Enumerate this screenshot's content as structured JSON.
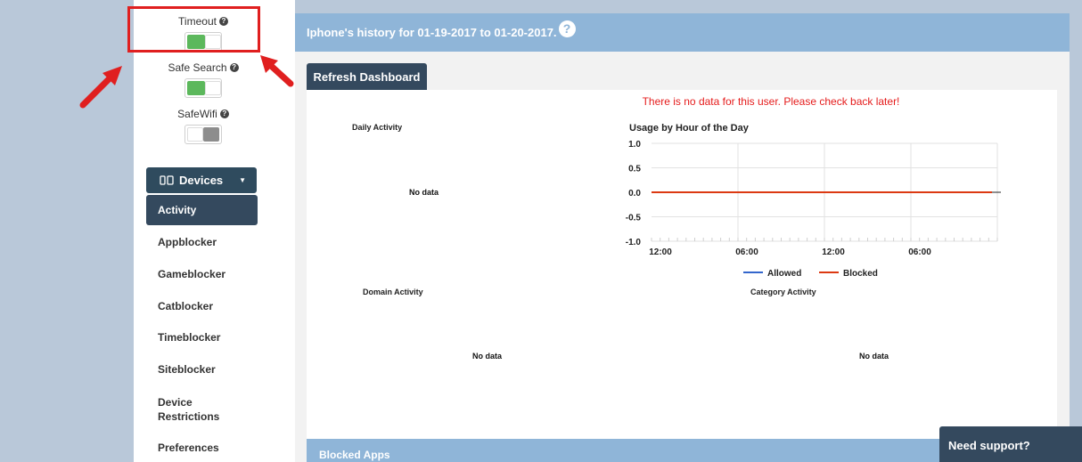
{
  "sidebar": {
    "toggles": [
      {
        "label": "Timeout",
        "state": "on"
      },
      {
        "label": "Safe Search",
        "state": "on"
      },
      {
        "label": "SafeWifi",
        "state": "off"
      }
    ],
    "help_glyph": "?",
    "devices_button": {
      "label": "Devices",
      "icons": [
        "phone-icon",
        "tablet-icon"
      ]
    },
    "nav_items": [
      {
        "label": "Activity",
        "active": true
      },
      {
        "label": "Appblocker"
      },
      {
        "label": "Gameblocker"
      },
      {
        "label": "Catblocker"
      },
      {
        "label": "Timeblocker"
      },
      {
        "label": "Siteblocker"
      },
      {
        "label": "Device Restrictions"
      },
      {
        "label": "Preferences"
      }
    ]
  },
  "main": {
    "header_title": "Iphone's history for 01-19-2017 to 01-20-2017.",
    "help_glyph": "?",
    "refresh_label": "Refresh Dashboard",
    "no_data_message": "There is no data for this user. Please check back later!",
    "daily_activity": {
      "title": "Daily Activity",
      "empty": "No data"
    },
    "domain_activity": {
      "title": "Domain Activity",
      "empty": "No data"
    },
    "category_activity": {
      "title": "Category Activity",
      "empty": "No data"
    },
    "blocked_apps_label": "Blocked Apps"
  },
  "support_label": "Need support?",
  "colors": {
    "accent_dark": "#34495e",
    "header_blue": "#8fb5d8",
    "toggle_on": "#5cb85c",
    "alert_red": "#e51c1c",
    "allowed_line": "#3366cc",
    "blocked_line": "#dc3912"
  },
  "chart_data": {
    "type": "line",
    "title": "Usage by Hour of the Day",
    "x_ticks": [
      "12:00",
      "06:00",
      "12:00",
      "06:00"
    ],
    "y_ticks": [
      "1.0",
      "0.5",
      "0.0",
      "-0.5",
      "-1.0"
    ],
    "ylim": [
      -1.0,
      1.0
    ],
    "series": [
      {
        "name": "Allowed",
        "color": "#3366cc",
        "values": [
          0,
          0
        ]
      },
      {
        "name": "Blocked",
        "color": "#dc3912",
        "values": [
          0,
          0
        ]
      }
    ],
    "legend": "bottom"
  }
}
